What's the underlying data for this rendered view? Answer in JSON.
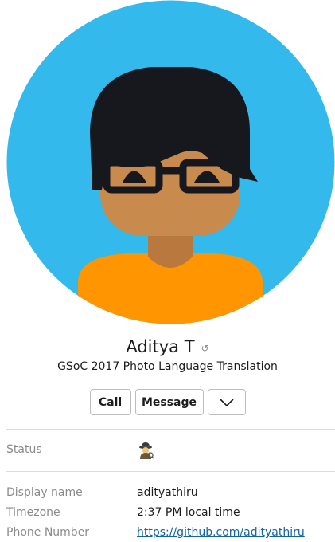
{
  "profile": {
    "name": "Aditya T",
    "subtitle": "GSoC 2017 Photo Language Translation"
  },
  "actions": {
    "call_label": "Call",
    "message_label": "Message"
  },
  "fields": {
    "status_label": "Status",
    "status_icon": "detective-emoji-icon",
    "display_name_label": "Display name",
    "display_name_value": "adityathiru",
    "timezone_label": "Timezone",
    "timezone_value": "2:37 PM local time",
    "phone_label": "Phone Number",
    "phone_value": "https://github.com/adityathiru"
  },
  "colors": {
    "avatar_bg": "#33b9ec",
    "hair": "#16181d",
    "skin": "#c98a4e",
    "shirt": "#ff9500",
    "link": "#1264a3"
  }
}
